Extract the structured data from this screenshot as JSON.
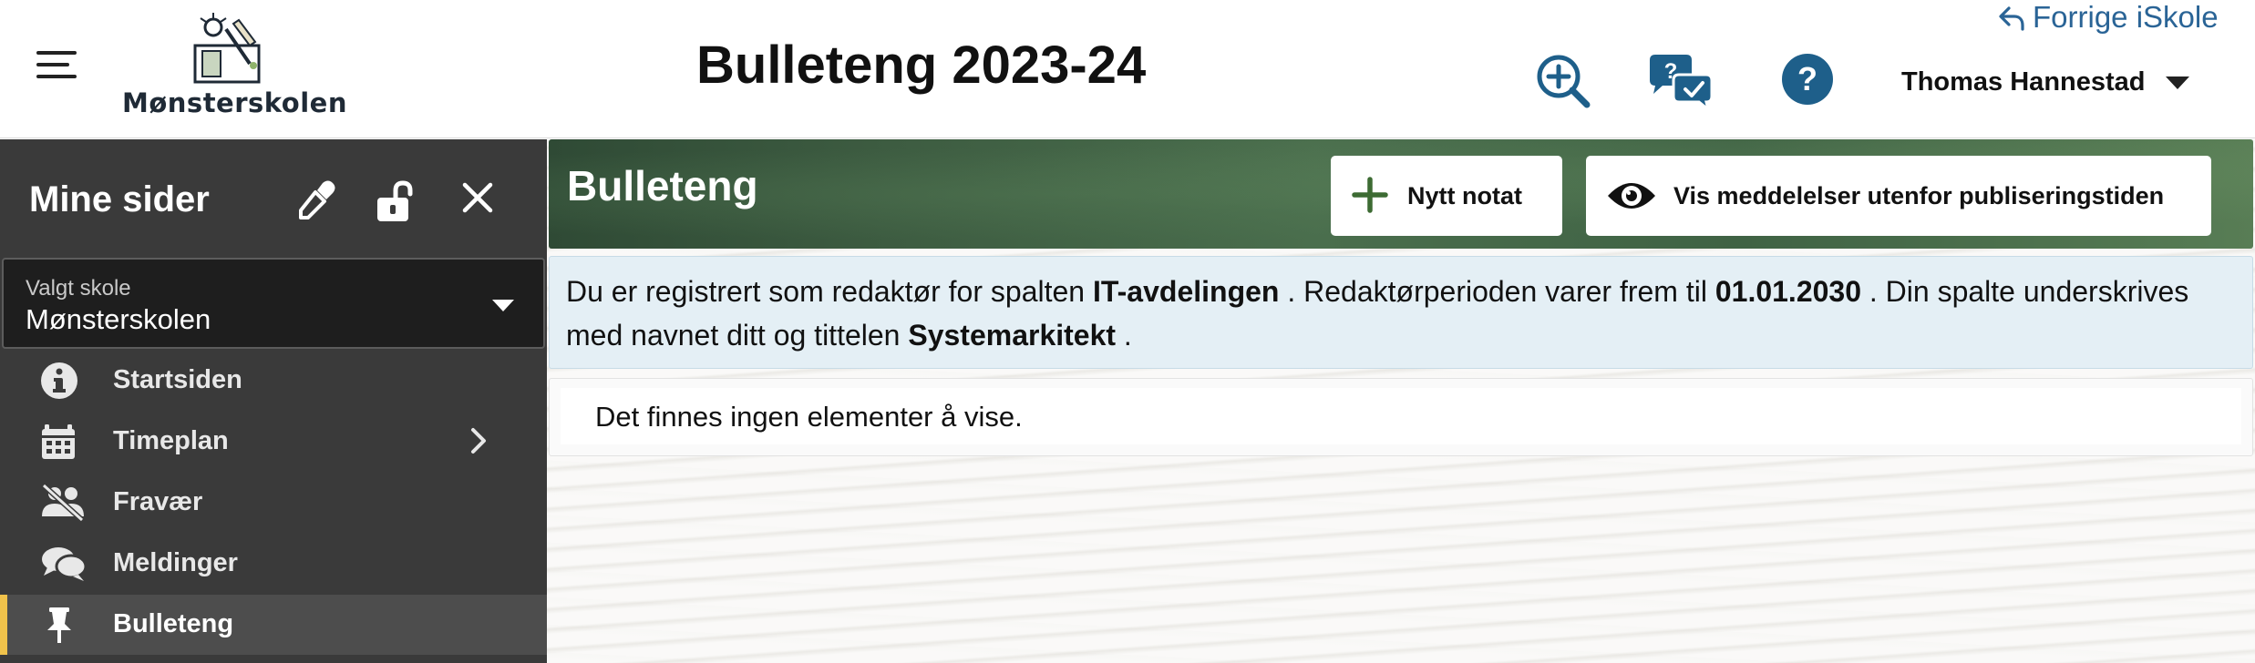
{
  "header": {
    "title": "Bulleteng 2023-24",
    "logo_text": "Mønsterskolen",
    "prev_link": "Forrige iSkole",
    "user_name": "Thomas Hannestad"
  },
  "sidebar": {
    "title": "Mine sider",
    "school_select": {
      "label": "Valgt skole",
      "value": "Mønsterskolen"
    },
    "items": [
      {
        "label": "Startsiden",
        "icon": "info-icon"
      },
      {
        "label": "Timeplan",
        "icon": "calendar-icon"
      },
      {
        "label": "Fravær",
        "icon": "absence-icon"
      },
      {
        "label": "Meldinger",
        "icon": "messages-icon"
      },
      {
        "label": "Bulleteng",
        "icon": "pin-icon"
      }
    ],
    "active_item": "Bulleteng",
    "active_color": "#f0c24b"
  },
  "main": {
    "banner_title": "Bulleteng",
    "new_note_label": "Nytt notat",
    "show_messages_label": "Vis meddelelser utenfor publiseringstiden",
    "info": {
      "part1": "Du er registrert som redaktør for spalten ",
      "column": "IT-avdelingen",
      "part2": " . Redaktørperioden varer frem til ",
      "date": "01.01.2030",
      "part3": " . Din spalte underskrives med navnet ditt og tittelen ",
      "title": "Systemarkitekt",
      "part4": " ."
    },
    "empty_text": "Det finnes ingen elementer å vise."
  },
  "colors": {
    "sidebar_bg": "#3a3a3a",
    "link": "#2a6496",
    "info_bg": "#e4eff5",
    "banner_green": "#3f6244"
  }
}
